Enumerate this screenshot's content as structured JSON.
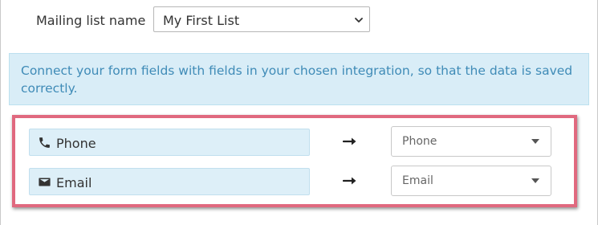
{
  "mailing_list": {
    "label": "Mailing list name",
    "selected": "My First List",
    "chevron_icon": "chevron-down-icon"
  },
  "info": {
    "text": "Connect your form fields with fields in your chosen integration, so that the data is saved correctly."
  },
  "mappings": [
    {
      "field_icon": "phone-icon",
      "field_label": "Phone",
      "arrow_icon": "arrow-right-icon",
      "target_value": "Phone",
      "target_caret_icon": "caret-down-icon"
    },
    {
      "field_icon": "envelope-icon",
      "field_label": "Email",
      "arrow_icon": "arrow-right-icon",
      "target_value": "Email",
      "target_caret_icon": "caret-down-icon"
    }
  ],
  "colors": {
    "info_background": "#d9edf7",
    "info_text": "#3f8bb7",
    "highlight_border": "#e0697f",
    "field_chip_background": "#ddeff8"
  }
}
